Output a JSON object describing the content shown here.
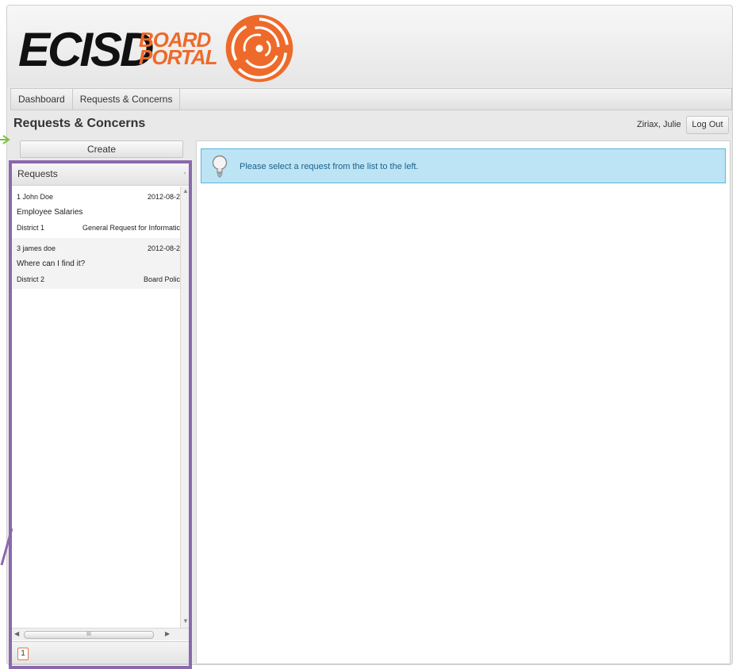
{
  "logo": {
    "main": "ECISD",
    "sub_top": "BOARD",
    "sub_bottom": "PORTAL"
  },
  "nav": {
    "items": [
      {
        "label": "Dashboard"
      },
      {
        "label": "Requests & Concerns"
      }
    ]
  },
  "page": {
    "title": "Requests & Concerns"
  },
  "user": {
    "name": "Ziriax, Julie",
    "logout_label": "Log Out"
  },
  "toolbar": {
    "create_label": "Create"
  },
  "requests": {
    "header": "Requests",
    "header_tick": "'",
    "items": [
      {
        "id_name": "1 John Doe",
        "date": "2012-08-2",
        "subject": "Employee Salaries",
        "district": "District 1",
        "category": "General Request for Informatic"
      },
      {
        "id_name": "3 james doe",
        "date": "2012-08-2",
        "subject": "Where can I find it?",
        "district": "District 2",
        "category": "Board Polic"
      }
    ],
    "scroll_thumb_grip": "III",
    "pager": {
      "current_page": "1"
    }
  },
  "info": {
    "message": "Please select a request from the list to the left."
  },
  "colors": {
    "logo_orange": "#ee6a2a",
    "info_bg": "#bde4f5",
    "info_border": "#5fb3de",
    "info_text": "#1d5f8a",
    "highlight_purple": "#8a69ac",
    "arrow_green": "#7dc242"
  },
  "icons": {
    "logo": "swirl-logo-icon",
    "info": "lightbulb-icon",
    "create_pointer": "arrow-right-icon"
  }
}
